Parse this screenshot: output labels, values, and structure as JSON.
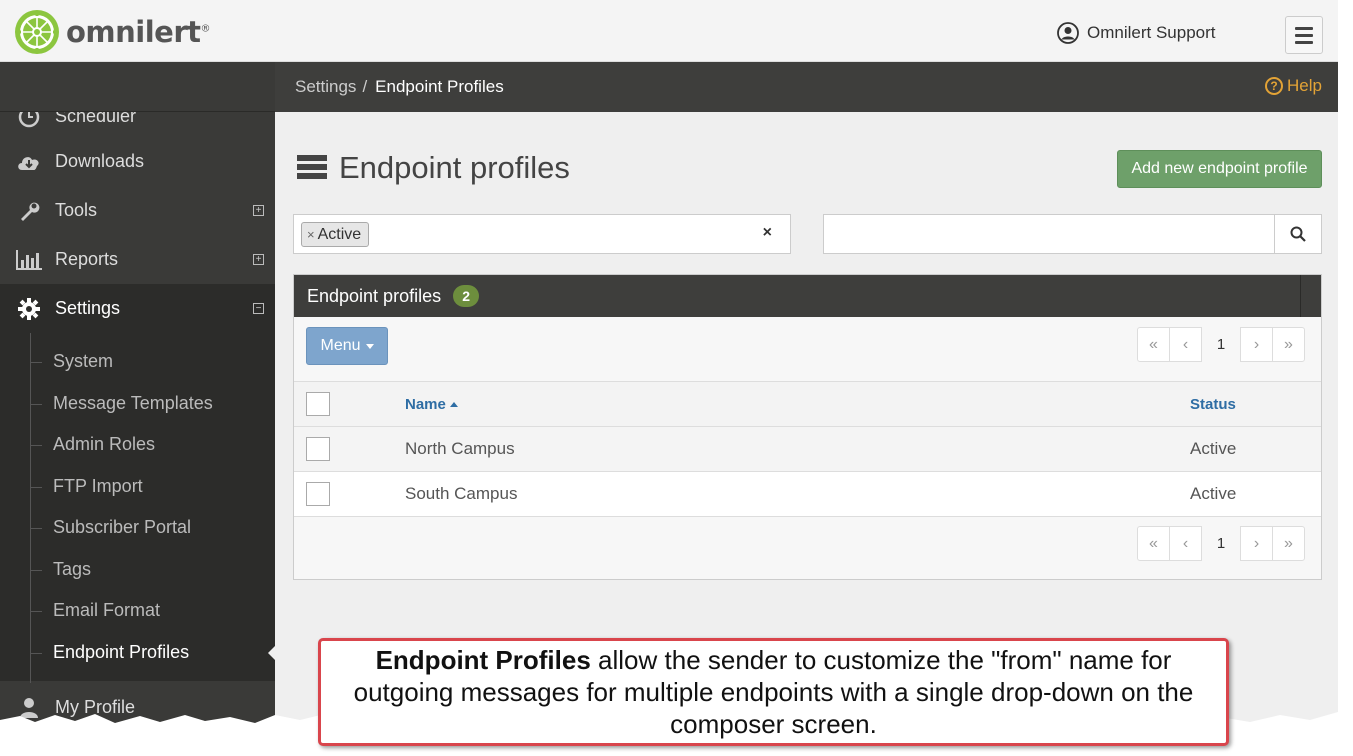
{
  "header": {
    "brand": "omnilert",
    "brand_mark": "®",
    "user_name": "Omnilert Support",
    "user_icon": "user-circle-icon",
    "menu_icon": "hamburger-icon",
    "brand_color": "#8cc63f"
  },
  "sidebar": {
    "items": [
      {
        "label": "Scheduler",
        "icon": "clock-icon"
      },
      {
        "label": "Downloads",
        "icon": "cloud-download-icon"
      },
      {
        "label": "Tools",
        "icon": "wrench-icon",
        "toggle": "⊞"
      },
      {
        "label": "Reports",
        "icon": "bar-chart-icon",
        "toggle": "⊞"
      },
      {
        "label": "Settings",
        "icon": "gear-icon",
        "toggle": "⊟"
      },
      {
        "label": "My Profile",
        "icon": "user-icon"
      }
    ],
    "settings_submenu": [
      {
        "label": "System"
      },
      {
        "label": "Message Templates"
      },
      {
        "label": "Admin Roles"
      },
      {
        "label": "FTP Import"
      },
      {
        "label": "Subscriber Portal"
      },
      {
        "label": "Tags"
      },
      {
        "label": "Email Format"
      },
      {
        "label": "Endpoint Profiles",
        "active": true
      }
    ]
  },
  "breadcrumb": {
    "parent": "Settings",
    "separator": "/",
    "current": "Endpoint Profiles"
  },
  "help": {
    "label": "Help",
    "symbol": "?"
  },
  "page": {
    "title": "Endpoint profiles",
    "add_button": "Add new endpoint profile",
    "filter_tag": "Active",
    "filter_tag_remove": "×",
    "filter_clear": "×",
    "search_value": ""
  },
  "panel": {
    "title": "Endpoint profiles",
    "count": "2",
    "menu_label": "Menu",
    "pager": {
      "first": "«",
      "prev": "‹",
      "page": "1",
      "next": "›",
      "last": "»"
    },
    "columns": {
      "name": "Name",
      "status": "Status"
    },
    "rows": [
      {
        "name": "North Campus",
        "status": "Active"
      },
      {
        "name": "South Campus",
        "status": "Active"
      }
    ]
  },
  "callout": {
    "bold": "Endpoint Profiles",
    "text": " allow the sender to customize the \"from\" name for outgoing messages for multiple endpoints with a single drop-down on the composer screen."
  },
  "colors": {
    "add_button": "#6ea06a",
    "menu_button": "#7ea5cd",
    "help": "#e3a336",
    "badge": "#6d8e3d",
    "callout_border": "#d9454c"
  }
}
